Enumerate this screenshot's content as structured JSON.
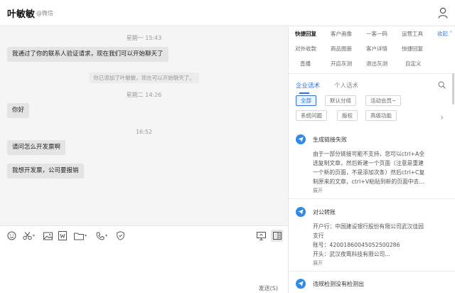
{
  "header": {
    "contact_name": "叶敏敏",
    "contact_source": "@微信"
  },
  "chat": {
    "messages": [
      {
        "type": "timestamp",
        "text": "星期一 15:43"
      },
      {
        "type": "bubble",
        "text": "我通过了你的联系人验证请求，现在我们可以开始聊天了"
      },
      {
        "type": "system",
        "text": "你已添加了叶敏敏，现在可以开始聊天了。"
      },
      {
        "type": "timestamp",
        "text": "星期二 14:26"
      },
      {
        "type": "bubble",
        "text": "你好"
      },
      {
        "type": "timestamp",
        "text": "16:52"
      },
      {
        "type": "bubble",
        "text": "请问怎么开发票啊"
      },
      {
        "type": "bubble",
        "text": "我想开发票，公司要报销"
      }
    ]
  },
  "toolbar": {
    "icons": [
      "emoji-icon",
      "scissors-icon",
      "image-icon",
      "word-file-icon",
      "folder-icon",
      "phone-icon",
      "shield-icon",
      "screen-share-icon",
      "sidebar-toggle-icon"
    ]
  },
  "input": {
    "send_label": "发送(S)"
  },
  "panel": {
    "nav_row1": [
      "快捷回复",
      "客户画像",
      "一客一码",
      "运营工具"
    ],
    "collapse_label": "收起",
    "nav_row2": [
      "对外收款",
      "商品图册",
      "客户详情",
      "快捷回复"
    ],
    "nav_row3": [
      "直播",
      "开启灰测",
      "退出灰测",
      "自定义"
    ],
    "subtabs": [
      "企业话术",
      "个人话术"
    ],
    "chips_row1": [
      "全部",
      "默认分组",
      "活动会员~"
    ],
    "chips_row2": [
      "系统问题",
      "版权",
      "高级功能"
    ],
    "items": [
      {
        "title": "生成链接失败",
        "lines": [
          "由于一部分链接可能不支持，您可以ctrl+A全",
          "选复制文章，然后新建一个页面（注意是重建",
          "一个新的页面，不是添加次条）然后ctrl+C复",
          "制原来的文章，ctrl+V粘贴到新的页面中去..."
        ],
        "expand": "展开"
      },
      {
        "title": "对公转账",
        "lines": [
          "开户行：中国建设银行股份有限公司武汉佳园",
          "支行",
          "账号：42001860045052500286",
          "开头：武汉夜莺科技有限公司..."
        ],
        "expand": "展开"
      },
      {
        "title": "违规检测没有检测出",
        "lines": [],
        "expand": ""
      }
    ]
  }
}
